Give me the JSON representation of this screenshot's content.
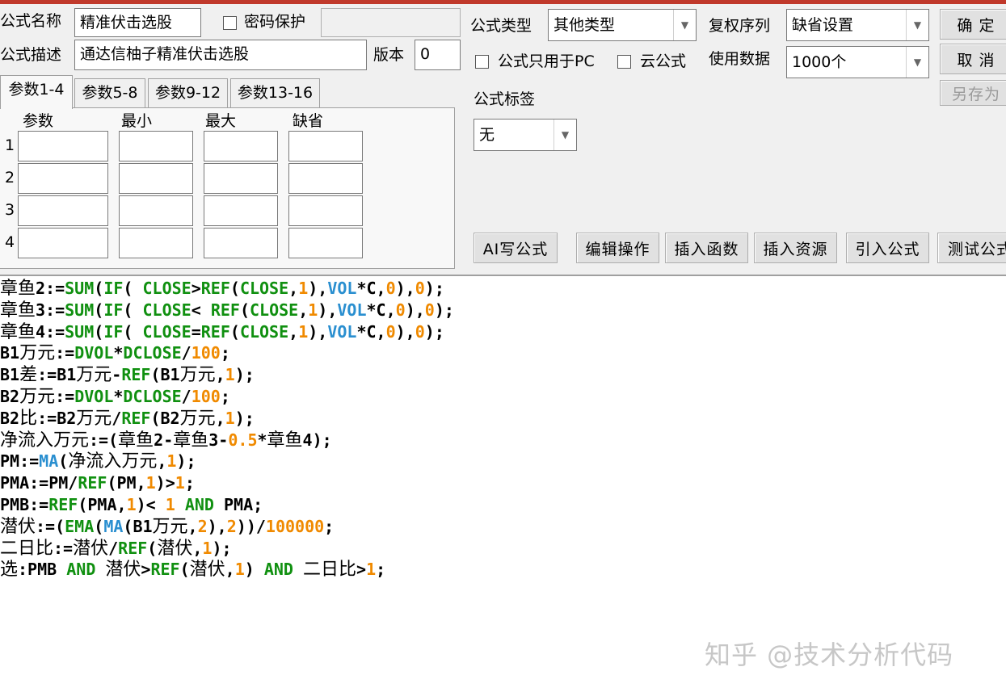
{
  "form": {
    "name_label": "公式名称",
    "name_value": "精准伏击选股",
    "password_label": "密码保护",
    "password_value": "",
    "desc_label": "公式描述",
    "desc_value": "通达信柚子精准伏击选股",
    "version_label": "版本",
    "version_value": "0",
    "type_label": "公式类型",
    "type_value": "其他类型",
    "restore_label": "复权序列",
    "restore_value": "缺省设置",
    "pc_only_label": "公式只用于PC",
    "cloud_label": "云公式",
    "data_label": "使用数据",
    "data_value": "1000个",
    "tag_label": "公式标签",
    "tag_value": "无"
  },
  "buttons": {
    "ok": "确 定",
    "cancel": "取 消",
    "save_as": "另存为",
    "ai_write": "AI写公式",
    "edit_ops": "编辑操作",
    "insert_func": "插入函数",
    "insert_res": "插入资源",
    "import_formula": "引入公式",
    "test_formula": "测试公式"
  },
  "tabs": [
    "参数1-4",
    "参数5-8",
    "参数9-12",
    "参数13-16"
  ],
  "param_table": {
    "headers": [
      "参数",
      "最小",
      "最大",
      "缺省"
    ],
    "rows": [
      "1",
      "2",
      "3",
      "4"
    ]
  },
  "code_lines": [
    [
      [
        "cn",
        "章鱼"
      ],
      [
        "p",
        "2:="
      ],
      [
        "fn",
        "SUM"
      ],
      [
        "p",
        "("
      ],
      [
        "fn",
        "IF"
      ],
      [
        "p",
        "( "
      ],
      [
        "fn",
        "CLOSE"
      ],
      [
        "p",
        ">"
      ],
      [
        "fn",
        "REF"
      ],
      [
        "p",
        "("
      ],
      [
        "fn",
        "CLOSE"
      ],
      [
        "p",
        ","
      ],
      [
        "num",
        "1"
      ],
      [
        "p",
        "),"
      ],
      [
        "blue",
        "VOL"
      ],
      [
        "p",
        "*C,"
      ],
      [
        "num",
        "0"
      ],
      [
        "p",
        "),"
      ],
      [
        "num",
        "0"
      ],
      [
        "p",
        ");"
      ]
    ],
    [
      [
        "cn",
        "章鱼"
      ],
      [
        "p",
        "3:="
      ],
      [
        "fn",
        "SUM"
      ],
      [
        "p",
        "("
      ],
      [
        "fn",
        "IF"
      ],
      [
        "p",
        "( "
      ],
      [
        "fn",
        "CLOSE"
      ],
      [
        "p",
        "< "
      ],
      [
        "fn",
        "REF"
      ],
      [
        "p",
        "("
      ],
      [
        "fn",
        "CLOSE"
      ],
      [
        "p",
        ","
      ],
      [
        "num",
        "1"
      ],
      [
        "p",
        "),"
      ],
      [
        "blue",
        "VOL"
      ],
      [
        "p",
        "*C,"
      ],
      [
        "num",
        "0"
      ],
      [
        "p",
        "),"
      ],
      [
        "num",
        "0"
      ],
      [
        "p",
        ");"
      ]
    ],
    [
      [
        "cn",
        "章鱼"
      ],
      [
        "p",
        "4:="
      ],
      [
        "fn",
        "SUM"
      ],
      [
        "p",
        "("
      ],
      [
        "fn",
        "IF"
      ],
      [
        "p",
        "( "
      ],
      [
        "fn",
        "CLOSE"
      ],
      [
        "p",
        "="
      ],
      [
        "fn",
        "REF"
      ],
      [
        "p",
        "("
      ],
      [
        "fn",
        "CLOSE"
      ],
      [
        "p",
        ","
      ],
      [
        "num",
        "1"
      ],
      [
        "p",
        "),"
      ],
      [
        "blue",
        "VOL"
      ],
      [
        "p",
        "*C,"
      ],
      [
        "num",
        "0"
      ],
      [
        "p",
        "),"
      ],
      [
        "num",
        "0"
      ],
      [
        "p",
        ");"
      ]
    ],
    [
      [
        "p",
        "B1"
      ],
      [
        "cn",
        "万元"
      ],
      [
        "p",
        ":="
      ],
      [
        "fn",
        "DVOL"
      ],
      [
        "p",
        "*"
      ],
      [
        "fn",
        "DCLOSE"
      ],
      [
        "p",
        "/"
      ],
      [
        "num",
        "100"
      ],
      [
        "p",
        ";"
      ]
    ],
    [
      [
        "p",
        "B1"
      ],
      [
        "cn",
        "差"
      ],
      [
        "p",
        ":=B1"
      ],
      [
        "cn",
        "万元"
      ],
      [
        "p",
        "-"
      ],
      [
        "fn",
        "REF"
      ],
      [
        "p",
        "(B1"
      ],
      [
        "cn",
        "万元"
      ],
      [
        "p",
        ","
      ],
      [
        "num",
        "1"
      ],
      [
        "p",
        ");"
      ]
    ],
    [
      [
        "p",
        "B2"
      ],
      [
        "cn",
        "万元"
      ],
      [
        "p",
        ":="
      ],
      [
        "fn",
        "DVOL"
      ],
      [
        "p",
        "*"
      ],
      [
        "fn",
        "DCLOSE"
      ],
      [
        "p",
        "/"
      ],
      [
        "num",
        "100"
      ],
      [
        "p",
        ";"
      ]
    ],
    [
      [
        "p",
        "B2"
      ],
      [
        "cn",
        "比"
      ],
      [
        "p",
        ":=B2"
      ],
      [
        "cn",
        "万元"
      ],
      [
        "p",
        "/"
      ],
      [
        "fn",
        "REF"
      ],
      [
        "p",
        "(B2"
      ],
      [
        "cn",
        "万元"
      ],
      [
        "p",
        ","
      ],
      [
        "num",
        "1"
      ],
      [
        "p",
        ");"
      ]
    ],
    [
      [
        "cn",
        "净流入万元"
      ],
      [
        "p",
        ":=("
      ],
      [
        "cn",
        "章鱼"
      ],
      [
        "p",
        "2-"
      ],
      [
        "cn",
        "章鱼"
      ],
      [
        "p",
        "3-"
      ],
      [
        "num",
        "0.5"
      ],
      [
        "p",
        "*"
      ],
      [
        "cn",
        "章鱼"
      ],
      [
        "p",
        "4);"
      ]
    ],
    [
      [
        "p",
        "PM:="
      ],
      [
        "blue",
        "MA"
      ],
      [
        "p",
        "("
      ],
      [
        "cn",
        "净流入万元"
      ],
      [
        "p",
        ","
      ],
      [
        "num",
        "1"
      ],
      [
        "p",
        ");"
      ]
    ],
    [
      [
        "p",
        "PMA:=PM/"
      ],
      [
        "fn",
        "REF"
      ],
      [
        "p",
        "(PM,"
      ],
      [
        "num",
        "1"
      ],
      [
        "p",
        ")>"
      ],
      [
        "num",
        "1"
      ],
      [
        "p",
        ";"
      ]
    ],
    [
      [
        "p",
        "PMB:="
      ],
      [
        "fn",
        "REF"
      ],
      [
        "p",
        "(PMA,"
      ],
      [
        "num",
        "1"
      ],
      [
        "p",
        ")< "
      ],
      [
        "num",
        "1"
      ],
      [
        "p",
        " "
      ],
      [
        "kw",
        "AND"
      ],
      [
        "p",
        " PMA;"
      ]
    ],
    [
      [
        "cn",
        "潜伏"
      ],
      [
        "p",
        ":=("
      ],
      [
        "fn",
        "EMA"
      ],
      [
        "p",
        "("
      ],
      [
        "blue",
        "MA"
      ],
      [
        "p",
        "(B1"
      ],
      [
        "cn",
        "万元"
      ],
      [
        "p",
        ","
      ],
      [
        "num",
        "2"
      ],
      [
        "p",
        "),"
      ],
      [
        "num",
        "2"
      ],
      [
        "p",
        "))/"
      ],
      [
        "num",
        "100000"
      ],
      [
        "p",
        ";"
      ]
    ],
    [
      [
        "cn",
        "二日比"
      ],
      [
        "p",
        ":="
      ],
      [
        "cn",
        "潜伏"
      ],
      [
        "p",
        "/"
      ],
      [
        "fn",
        "REF"
      ],
      [
        "p",
        "("
      ],
      [
        "cn",
        "潜伏"
      ],
      [
        "p",
        ","
      ],
      [
        "num",
        "1"
      ],
      [
        "p",
        ");"
      ]
    ],
    [
      [
        "cn",
        "选"
      ],
      [
        "p",
        ":PMB "
      ],
      [
        "kw",
        "AND"
      ],
      [
        "p",
        " "
      ],
      [
        "cn",
        "潜伏"
      ],
      [
        "p",
        ">"
      ],
      [
        "fn",
        "REF"
      ],
      [
        "p",
        "("
      ],
      [
        "cn",
        "潜伏"
      ],
      [
        "p",
        ","
      ],
      [
        "num",
        "1"
      ],
      [
        "p",
        ") "
      ],
      [
        "kw",
        "AND"
      ],
      [
        "p",
        " "
      ],
      [
        "cn",
        "二日比"
      ],
      [
        "p",
        ">"
      ],
      [
        "num",
        "1"
      ],
      [
        "p",
        ";"
      ]
    ]
  ],
  "watermark": "知乎 @技术分析代码",
  "colors": {
    "function": "#109010",
    "number": "#f08a00",
    "builtin_blue": "#2a8fd0",
    "top_strip": "#c0392b"
  }
}
